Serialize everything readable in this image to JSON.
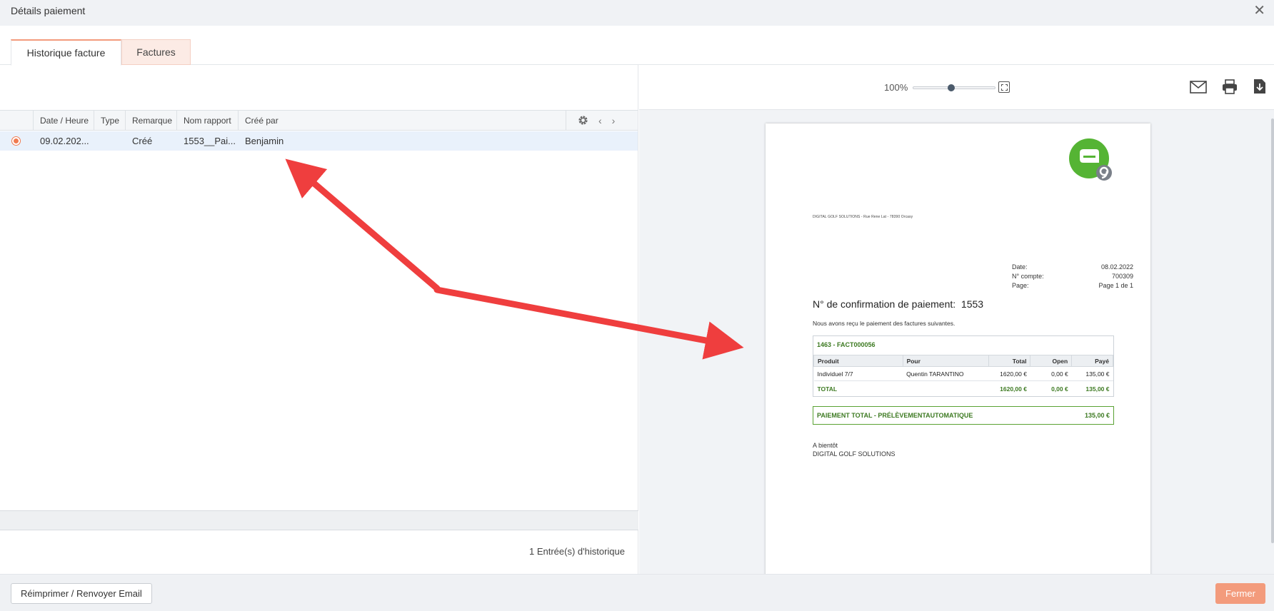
{
  "window": {
    "title": "Détails paiement"
  },
  "tabs": [
    {
      "label": "Historique facture",
      "active": true
    },
    {
      "label": "Factures",
      "active": false
    }
  ],
  "grid": {
    "columns": [
      "Date / Heure",
      "Type",
      "Remarque",
      "Nom rapport",
      "Créé par"
    ],
    "rows": [
      {
        "selected": true,
        "date": "09.02.202...",
        "type": "",
        "remarque": "Créé",
        "nom_rapport": "1553__Pai...",
        "cree_par": "Benjamin"
      }
    ],
    "count_label": "1 Entrée(s) d'historique"
  },
  "viewer": {
    "zoom_label": "100%",
    "zoom_level": 0.42
  },
  "document": {
    "sender_line": "DIGITAL GOLF SOLUTIONS - Rue Rene Lat - 78390 Orcasy",
    "meta": [
      {
        "label": "Date:",
        "value": "08.02.2022"
      },
      {
        "label": "N° compte:",
        "value": "700309"
      },
      {
        "label": "Page:",
        "value": "Page 1 de 1"
      }
    ],
    "heading": "N° de confirmation de paiement:  1553",
    "intro": "Nous avons reçu le paiement des factures suivantes.",
    "invoice_title": "1463 - FACT000056",
    "table_headers": [
      "Produit",
      "Pour",
      "Total",
      "Open",
      "Payé"
    ],
    "table_rows": [
      [
        "Individuel 7/7",
        "Quentin TARANTINO",
        "1620,00 €",
        "0,00 €",
        "135,00 €"
      ]
    ],
    "total_row": [
      "TOTAL",
      "",
      "1620,00 €",
      "0,00 €",
      "135,00 €"
    ],
    "payment_label": "PAIEMENT TOTAL - PRÉLÈVEMENTAUTOMATIQUE",
    "payment_amount": "135,00 €",
    "closing_1": "A bientôt",
    "closing_2": "DIGITAL GOLF SOLUTIONS"
  },
  "footer": {
    "reprint_label": "Réimprimer / Renvoyer Email",
    "close_label": "Fermer"
  },
  "colors": {
    "accent": "#f39b7c",
    "radio": "#f07a50",
    "doc_green": "#3d7a22",
    "logo_green": "#55b434",
    "arrow_red": "#ef3e3e"
  }
}
